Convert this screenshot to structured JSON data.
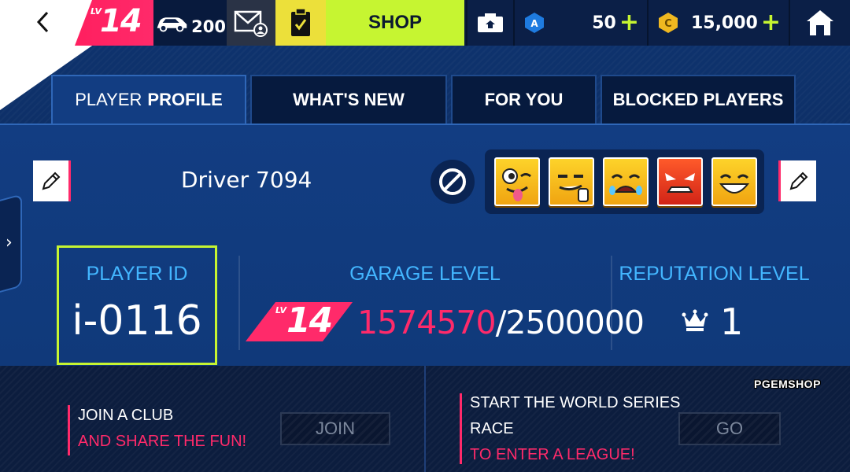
{
  "topbar": {
    "level_prefix": "LV",
    "level": "14",
    "cars_count": "200",
    "shop_label": "SHOP",
    "tokens": "50",
    "coins": "15,000",
    "plus": "+"
  },
  "tabs": [
    {
      "prefix": "PLAYER",
      "label": "PROFILE"
    },
    {
      "label": "WHAT'S NEW"
    },
    {
      "label": "FOR YOU"
    },
    {
      "label": "BLOCKED PLAYERS"
    }
  ],
  "profile": {
    "driver_name": "Driver 7094",
    "emotes": [
      "wink-tongue-emote",
      "smirk-thumb-emote",
      "crying-emote",
      "angry-emote",
      "grin-emote"
    ]
  },
  "stats": {
    "player_id_label": "PLAYER ID",
    "player_id": "i-0116",
    "garage_label": "GARAGE LEVEL",
    "garage_level_prefix": "LV",
    "garage_level": "14",
    "garage_current": "1574570",
    "garage_sep_total": "/2500000",
    "garage_progress_fraction": 0.63,
    "reputation_label": "REPUTATION LEVEL",
    "reputation": "1"
  },
  "promos": {
    "club_line1": "JOIN A CLUB",
    "club_line2": "AND SHARE THE FUN!",
    "join_label": "JOIN",
    "series_line1": "START THE WORLD SERIES",
    "series_line2": "RACE",
    "series_line3": "TO ENTER A LEAGUE!",
    "go_label": "GO"
  },
  "watermark": "PGEMSHOP",
  "colors": {
    "accent_pink": "#ff2a6a",
    "accent_lime": "#c6f531",
    "label_blue": "#43b6ff",
    "panel_blue": "#123d82"
  }
}
